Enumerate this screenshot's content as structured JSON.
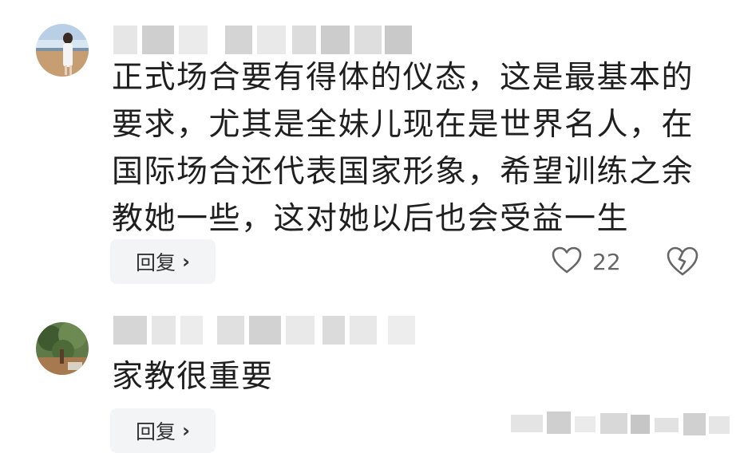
{
  "comments": [
    {
      "text": "正式场合要有得体的仪态，这是最基本的要求，尤其是全妹儿现在是世界名人，在国际场合还代表国家形象，希望训练之余教她一些，这对她以后也会受益一生",
      "reply_label": "回复",
      "reply_chevron": "›",
      "like_count": "22"
    },
    {
      "text": "家教很重要",
      "reply_label": "回复",
      "reply_chevron": "›"
    }
  ],
  "icons": {
    "like": "heart-outline-icon",
    "dislike": "broken-heart-outline-icon"
  },
  "colors": {
    "text": "#1f1f1f",
    "reply_bg": "#f3f4f6",
    "icon_gray": "#666666"
  }
}
